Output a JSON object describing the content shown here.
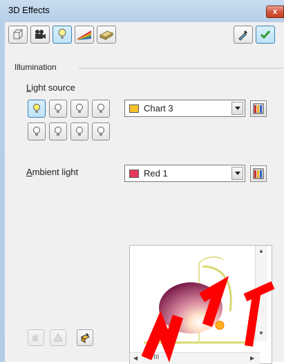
{
  "window": {
    "title": "3D Effects",
    "close_label": "x"
  },
  "toolbar": {
    "buttons": [
      {
        "name": "geometry",
        "icon": "cube-icon"
      },
      {
        "name": "shading",
        "icon": "camera-icon"
      },
      {
        "name": "illumination",
        "icon": "lightbulb-icon",
        "active": true
      },
      {
        "name": "textures",
        "icon": "rainbow-icon"
      },
      {
        "name": "material",
        "icon": "soap-icon"
      }
    ],
    "right": [
      {
        "name": "assign",
        "icon": "eyedropper-icon"
      },
      {
        "name": "update",
        "icon": "checkmark-icon"
      }
    ]
  },
  "section": {
    "title": "Illumination"
  },
  "light_source": {
    "label": "Light source",
    "mnemonic": "L",
    "rest": "ight source",
    "selected_index": 0,
    "color": {
      "label": "Chart 3",
      "swatch": "#f5c22a"
    }
  },
  "ambient": {
    "label": "Ambient light",
    "mnemonic": "A",
    "rest": "mbient light",
    "color": {
      "label": "Red 1",
      "swatch": "#e8395d"
    }
  },
  "preview": {
    "hscroll_text": "III"
  }
}
